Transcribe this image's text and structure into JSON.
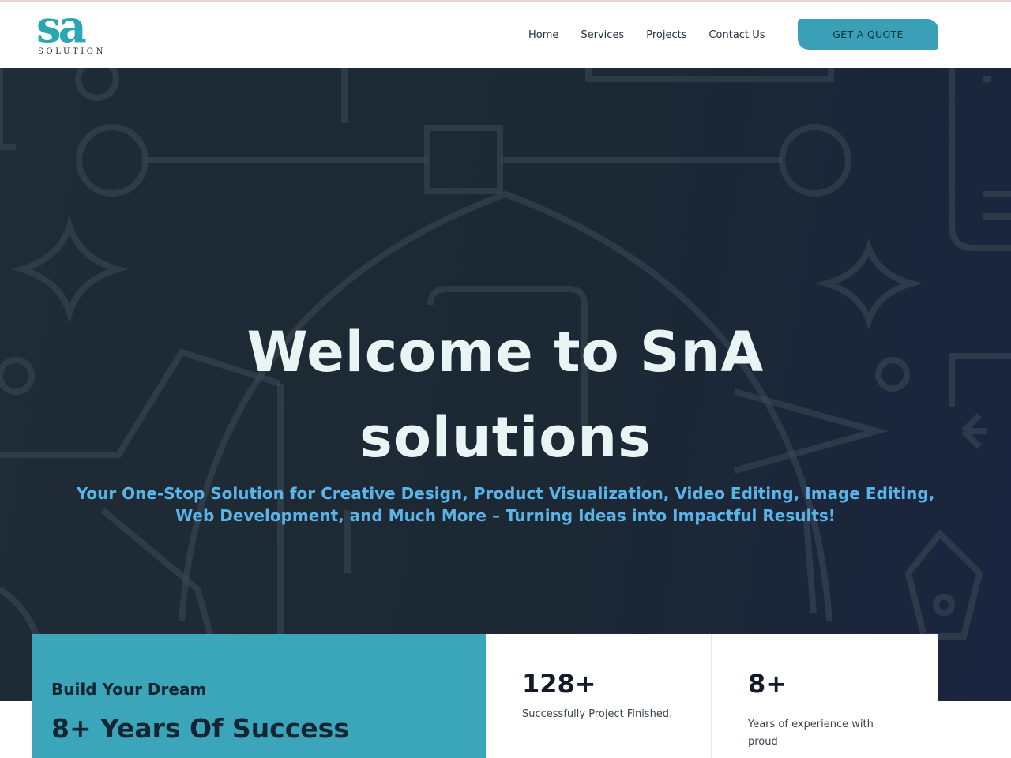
{
  "brand": {
    "logo_mark": "sa",
    "logo_sub": "SOLUTION"
  },
  "nav": {
    "items": [
      {
        "label": "Home"
      },
      {
        "label": "Services"
      },
      {
        "label": "Projects"
      },
      {
        "label": "Contact Us"
      }
    ],
    "cta_label": "GET A QUOTE"
  },
  "hero": {
    "title": "Welcome to SnA solutions",
    "subtitle": "Your One-Stop Solution for Creative Design, Product Visualization, Video Editing, Image Editing, Web Development, and Much More – Turning Ideas into Impactful Results!"
  },
  "stats": {
    "eyebrow": "Build Your Dream",
    "headline": "8+ Years Of Success",
    "items": [
      {
        "value": "128+",
        "label": "Successfully Project Finished."
      },
      {
        "value": "8+",
        "label": "Years of experience with proud"
      }
    ]
  },
  "colors": {
    "accent": "#3aa0b8",
    "hero_bg": "#1f2c36",
    "hero_subtitle": "#5bb4e8",
    "logo": "#2aa7b0"
  }
}
